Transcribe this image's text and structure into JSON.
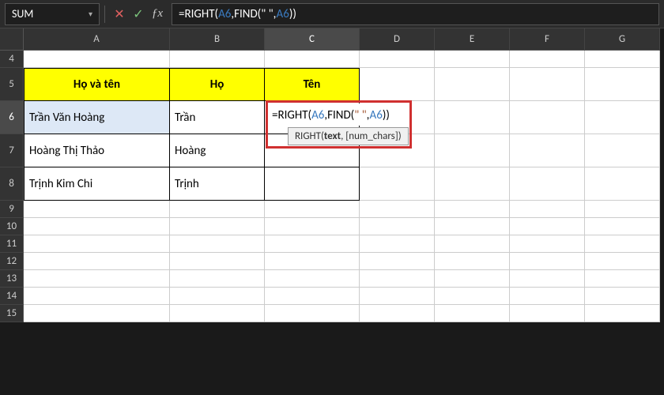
{
  "name_box": "SUM",
  "formula_bar": {
    "raw": "=RIGHT(A6,FIND(\" \",A6))",
    "prefix": "=RIGHT(",
    "ref1": "A6",
    "mid1": ",FIND(",
    "str": "\" \"",
    "mid2": ",",
    "ref2": "A6",
    "suffix": "))"
  },
  "tooltip": {
    "fn": "RIGHT(",
    "arg1": "text",
    "sep": ", ",
    "arg2": "[num_chars]",
    "close": ")"
  },
  "columns": [
    "A",
    "B",
    "C",
    "D",
    "E",
    "F",
    "G"
  ],
  "row_labels": [
    "4",
    "5",
    "6",
    "7",
    "8",
    "9",
    "10",
    "11",
    "12",
    "13",
    "14",
    "15"
  ],
  "headers": {
    "A": "Họ và tên",
    "B": "Họ",
    "C": "Tên"
  },
  "data_rows": [
    {
      "A": "Trần Văn Hoàng",
      "B": "Trần",
      "C": ""
    },
    {
      "A": "Hoàng Thị Thảo",
      "B": "Hoàng",
      "C": ""
    },
    {
      "A": "Trịnh Kim Chi",
      "B": "Trịnh",
      "C": ""
    }
  ],
  "active_cell": "C6",
  "chart_data": {
    "type": "table",
    "columns": [
      "Họ và tên",
      "Họ",
      "Tên"
    ],
    "rows": [
      [
        "Trần Văn Hoàng",
        "Trần",
        "=RIGHT(A6,FIND(\" \",A6))"
      ],
      [
        "Hoàng Thị Thảo",
        "Hoàng",
        ""
      ],
      [
        "Trịnh Kim Chi",
        "Trịnh",
        ""
      ]
    ]
  }
}
